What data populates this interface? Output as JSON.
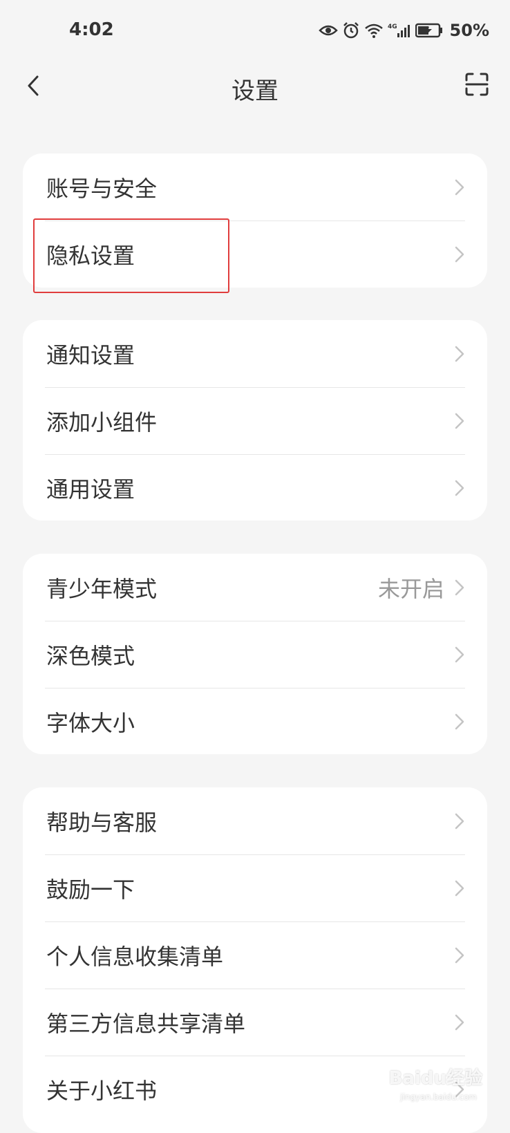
{
  "status_bar": {
    "time": "4:02",
    "battery": "50%",
    "icons": [
      "eye-icon",
      "alarm-icon",
      "wifi-icon",
      "signal-4g-icon",
      "battery-icon"
    ]
  },
  "nav": {
    "title": "设置",
    "back_icon": "back-arrow-icon",
    "scan_icon": "scan-icon"
  },
  "groups": [
    {
      "items": [
        {
          "label": "账号与安全"
        },
        {
          "label": "隐私设置"
        }
      ]
    },
    {
      "items": [
        {
          "label": "通知设置"
        },
        {
          "label": "添加小组件"
        },
        {
          "label": "通用设置"
        }
      ]
    },
    {
      "items": [
        {
          "label": "青少年模式",
          "value": "未开启"
        },
        {
          "label": "深色模式"
        },
        {
          "label": "字体大小"
        }
      ]
    },
    {
      "items": [
        {
          "label": "帮助与客服"
        },
        {
          "label": "鼓励一下"
        },
        {
          "label": "个人信息收集清单"
        },
        {
          "label": "第三方信息共享清单"
        },
        {
          "label": "关于小红书"
        }
      ]
    }
  ],
  "highlight": {
    "target": "隐私设置",
    "color": "#e03c3c"
  },
  "watermark": {
    "text": "Baidu经验",
    "sub": "jingyan.baidu.com"
  }
}
